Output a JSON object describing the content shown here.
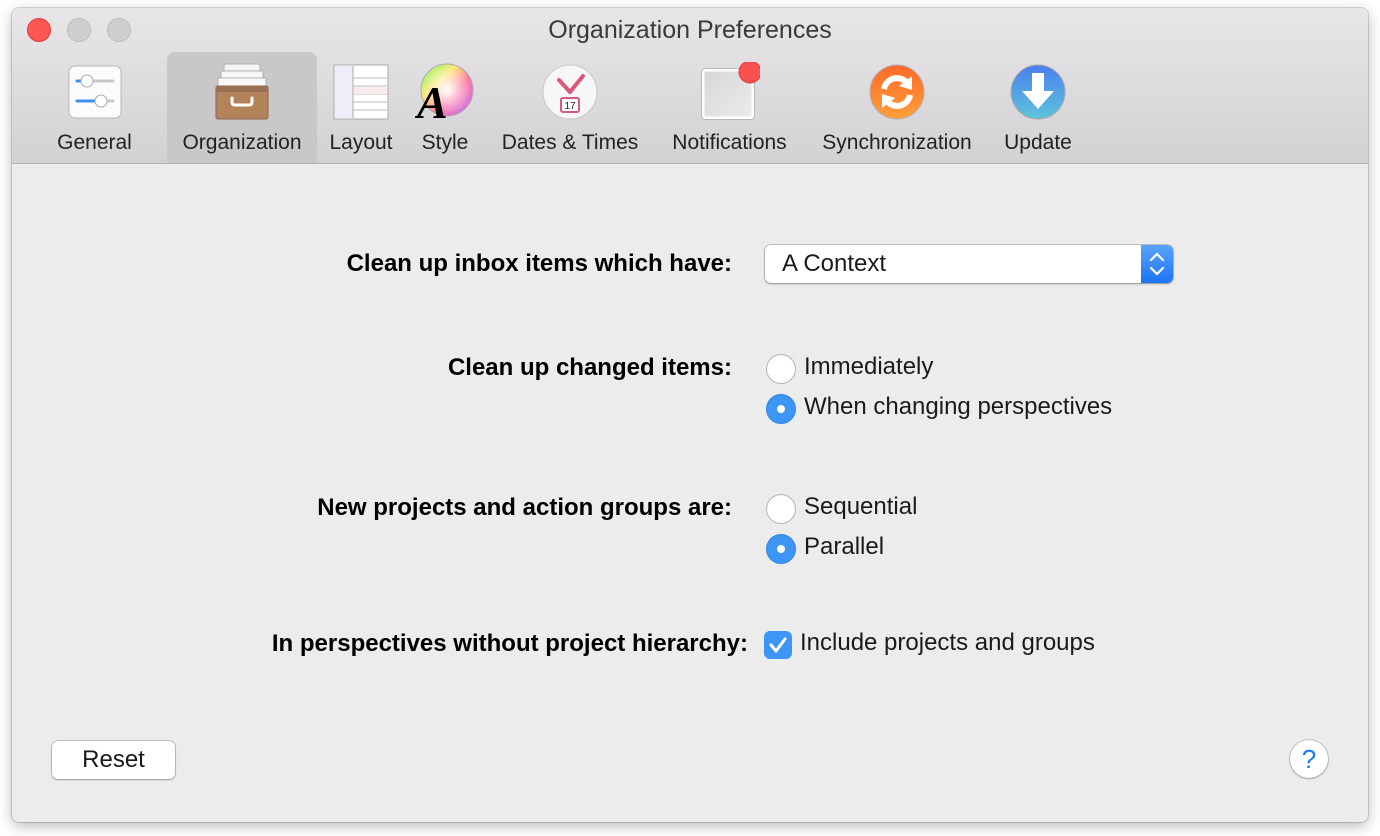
{
  "window": {
    "title": "Organization Preferences"
  },
  "toolbar": {
    "tabs": [
      {
        "id": "general",
        "label": "General",
        "icon": "sliders-icon",
        "selected": false
      },
      {
        "id": "organization",
        "label": "Organization",
        "icon": "file-drawer-icon",
        "selected": true
      },
      {
        "id": "layout",
        "label": "Layout",
        "icon": "layout-icon",
        "selected": false
      },
      {
        "id": "style",
        "label": "Style",
        "icon": "font-color-wheel-icon",
        "selected": false
      },
      {
        "id": "dates-times",
        "label": "Dates & Times",
        "icon": "clock-calendar-icon",
        "calendar_day": "17",
        "selected": false
      },
      {
        "id": "notifications",
        "label": "Notifications",
        "icon": "notification-badge-icon",
        "selected": false
      },
      {
        "id": "synchronization",
        "label": "Synchronization",
        "icon": "sync-icon",
        "selected": false
      },
      {
        "id": "update",
        "label": "Update",
        "icon": "download-arrow-icon",
        "selected": false
      }
    ]
  },
  "settings": {
    "inbox_cleanup": {
      "label": "Clean up inbox items which have:",
      "selected": "A Context"
    },
    "changed_items": {
      "label": "Clean up changed items:",
      "options": [
        {
          "label": "Immediately",
          "checked": false
        },
        {
          "label": "When changing perspectives",
          "checked": true
        }
      ]
    },
    "new_projects": {
      "label": "New projects and action groups are:",
      "options": [
        {
          "label": "Sequential",
          "checked": false
        },
        {
          "label": "Parallel",
          "checked": true
        }
      ]
    },
    "perspectives": {
      "label": "In perspectives without project hierarchy:",
      "checkbox_label": "Include projects and groups",
      "checked": true
    }
  },
  "footer": {
    "reset_label": "Reset",
    "help_label": "?"
  },
  "colors": {
    "accent": "#3d95f5",
    "close": "#fc5753",
    "help": "#1a7cf5"
  }
}
